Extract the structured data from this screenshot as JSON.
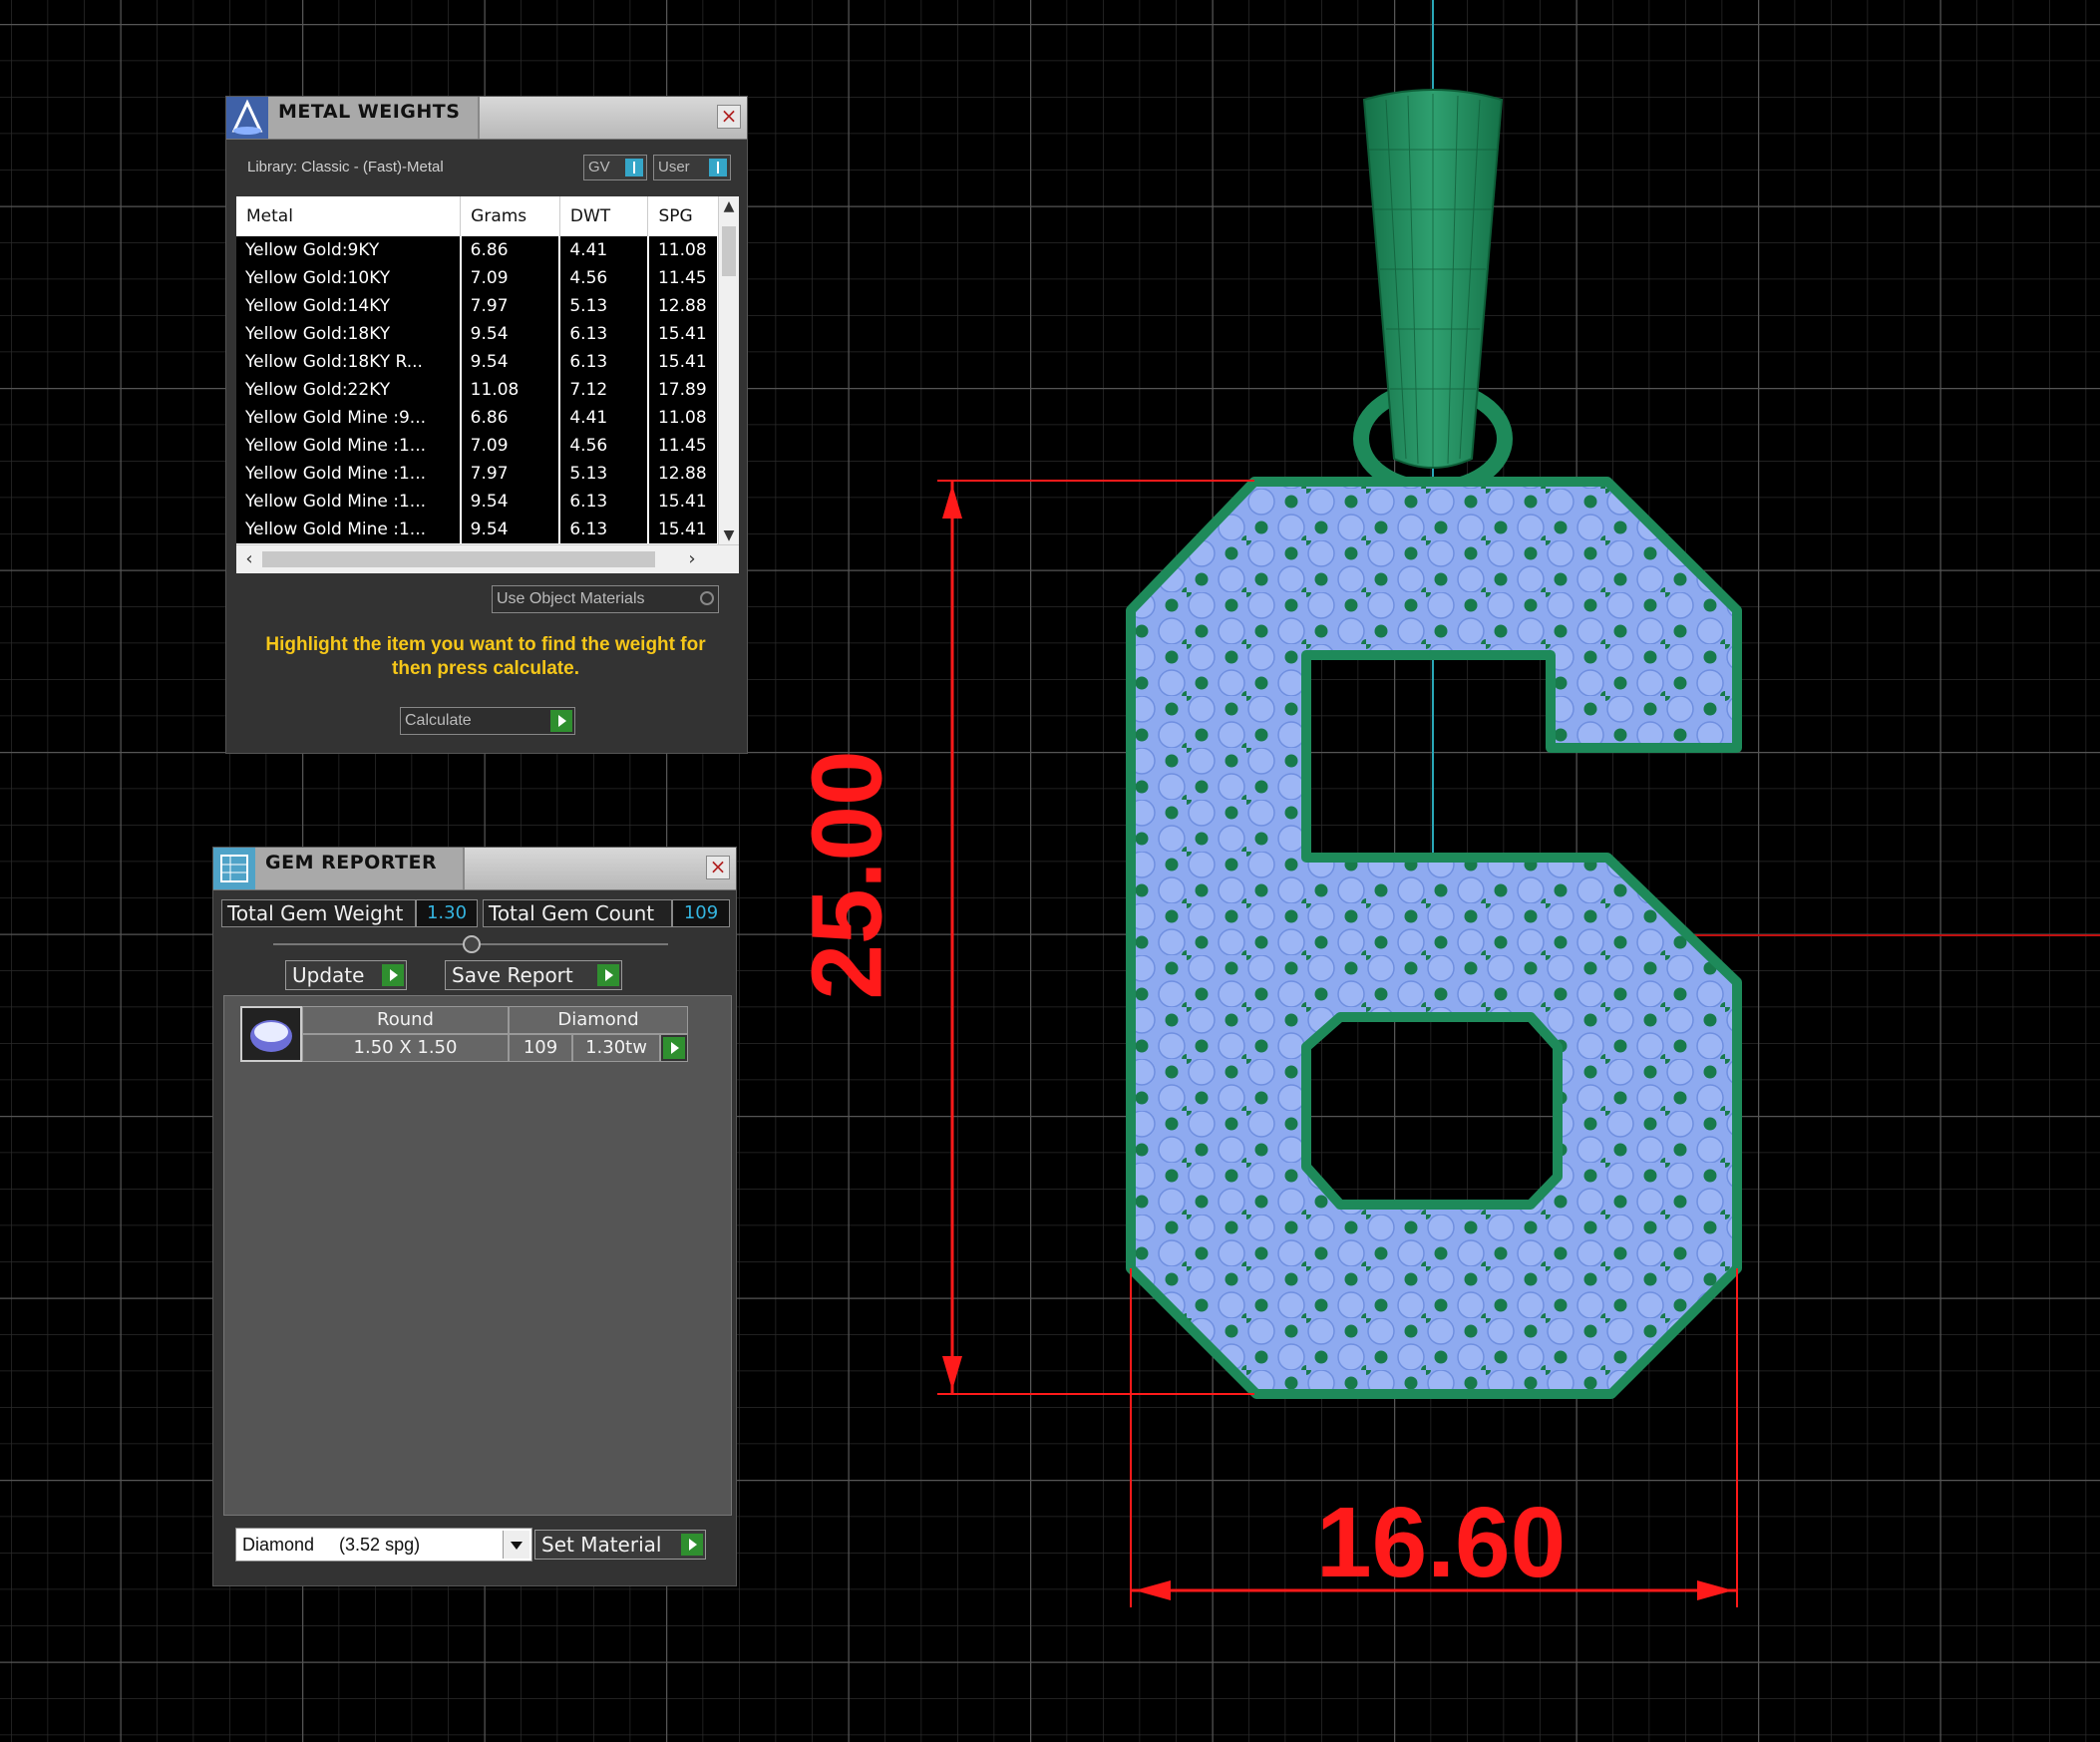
{
  "metal_weights": {
    "title": "METAL WEIGHTS",
    "library_label": "Library: Classic - (Fast)-Metal",
    "toggle_gv": "GV",
    "toggle_user": "User",
    "columns": [
      "Metal",
      "Grams",
      "DWT",
      "SPG"
    ],
    "rows": [
      {
        "metal": "Yellow Gold:9KY",
        "grams": "6.86",
        "dwt": "4.41",
        "spg": "11.08"
      },
      {
        "metal": "Yellow Gold:10KY",
        "grams": "7.09",
        "dwt": "4.56",
        "spg": "11.45"
      },
      {
        "metal": "Yellow Gold:14KY",
        "grams": "7.97",
        "dwt": "5.13",
        "spg": "12.88"
      },
      {
        "metal": "Yellow Gold:18KY",
        "grams": "9.54",
        "dwt": "6.13",
        "spg": "15.41"
      },
      {
        "metal": "Yellow Gold:18KY R...",
        "grams": "9.54",
        "dwt": "6.13",
        "spg": "15.41"
      },
      {
        "metal": "Yellow Gold:22KY",
        "grams": "11.08",
        "dwt": "7.12",
        "spg": "17.89"
      },
      {
        "metal": "Yellow Gold Mine :9...",
        "grams": "6.86",
        "dwt": "4.41",
        "spg": "11.08"
      },
      {
        "metal": "Yellow Gold Mine :1...",
        "grams": "7.09",
        "dwt": "4.56",
        "spg": "11.45"
      },
      {
        "metal": "Yellow Gold Mine :1...",
        "grams": "7.97",
        "dwt": "5.13",
        "spg": "12.88"
      },
      {
        "metal": "Yellow Gold Mine :1...",
        "grams": "9.54",
        "dwt": "6.13",
        "spg": "15.41"
      },
      {
        "metal": "Yellow Gold Mine :1...",
        "grams": "9.54",
        "dwt": "6.13",
        "spg": "15.41"
      }
    ],
    "use_object_materials": "Use Object Materials",
    "hint": "Highlight the item you want to find the weight for then press calculate.",
    "calculate_label": "Calculate"
  },
  "gem_reporter": {
    "title": "GEM REPORTER",
    "total_weight_label": "Total Gem Weight",
    "total_weight_value": "1.30",
    "total_count_label": "Total Gem Count",
    "total_count_value": "109",
    "update_label": "Update",
    "save_report_label": "Save Report",
    "gem": {
      "shape": "Round",
      "material": "Diamond",
      "size": "1.50 X 1.50",
      "count": "109",
      "weight": "1.30tw"
    },
    "material_select": "Diamond     (3.52 spg)",
    "set_material_label": "Set Material"
  },
  "viewport": {
    "height_dimension": "25.00",
    "width_dimension": "16.60",
    "colors": {
      "background": "#000000",
      "grid_major": "#4a4a4a",
      "grid_minor": "#262626",
      "metal": "#1e8a5a",
      "gem": "#86a6f0",
      "dimension": "#ff1a1a",
      "axis": "#2aa7b7"
    }
  }
}
